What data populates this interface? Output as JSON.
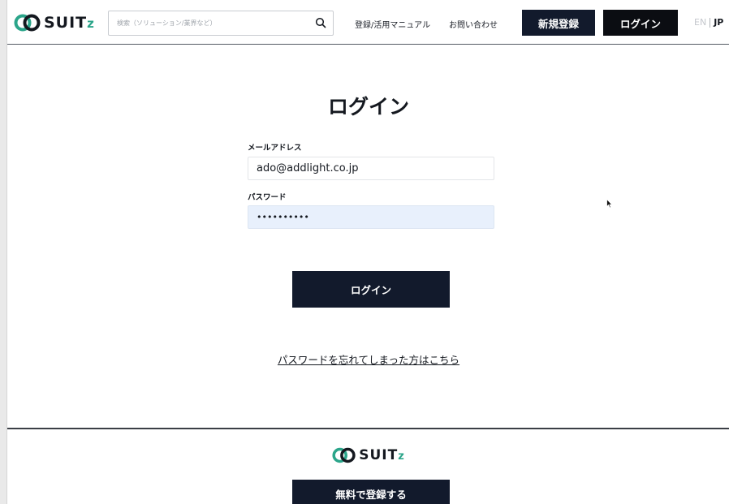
{
  "header": {
    "logo_text": "SUIT",
    "logo_suffix": "z",
    "search_placeholder": "検索（ソリューション/業界など）",
    "nav_manual": "登録/活用マニュアル",
    "nav_contact": "お問い合わせ",
    "signup_button": "新規登録",
    "login_button": "ログイン",
    "lang_en": "EN",
    "lang_jp": "JP"
  },
  "main": {
    "title": "ログイン",
    "email_label": "メールアドレス",
    "email_value": "ado@addlight.co.jp",
    "password_label": "パスワード",
    "password_mask": "••••••••••",
    "login_button": "ログイン",
    "forgot_link": "パスワードを忘れてしまった方はこちら"
  },
  "footer": {
    "logo_text": "SUIT",
    "logo_suffix": "z",
    "signup_button": "無料で登録する"
  },
  "colors": {
    "navy": "#121a2c",
    "brand_green": "#2ba58a",
    "autofill_blue": "#e8f0fc"
  }
}
